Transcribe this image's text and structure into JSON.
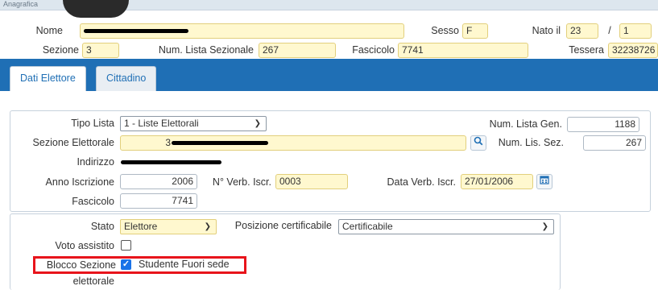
{
  "header": {
    "breadcrumb": "Anagrafica",
    "nome_label": "Nome",
    "sesso_label": "Sesso",
    "sesso_value": "F",
    "nato_il_label": "Nato il",
    "nato_day": "23",
    "date_sep": "/",
    "nato_month": "1",
    "sezione_label": "Sezione",
    "sezione_value": "3",
    "num_lista_sezionale_label": "Num. Lista Sezionale",
    "num_lista_sezionale_value": "267",
    "fascicolo_label": "Fascicolo",
    "fascicolo_value": "7741",
    "tessera_label": "Tessera",
    "tessera_value": "32238726"
  },
  "tabs": [
    {
      "label": "Dati Elettore",
      "active": true
    },
    {
      "label": "Cittadino",
      "active": false
    }
  ],
  "elettore": {
    "tipo_lista_label": "Tipo Lista",
    "tipo_lista_value": "1 - Liste Elettorali",
    "num_lista_gen_label": "Num. Lista Gen.",
    "num_lista_gen_value": "1188",
    "sezione_elettorale_label": "Sezione Elettorale",
    "sezione_elettorale_value": "3",
    "num_lis_sez_label": "Num. Lis. Sez.",
    "num_lis_sez_value": "267",
    "indirizzo_label": "Indirizzo",
    "anno_iscrizione_label": "Anno Iscrizione",
    "anno_iscrizione_value": "2006",
    "n_verb_iscr_label": "N° Verb. Iscr.",
    "n_verb_iscr_value": "0003",
    "data_verb_iscr_label": "Data Verb. Iscr.",
    "data_verb_iscr_value": "27/01/2006",
    "fascicolo_label": "Fascicolo",
    "fascicolo_value": "7741"
  },
  "stato": {
    "stato_label": "Stato",
    "stato_value": "Elettore",
    "posizione_label": "Posizione certificabile",
    "posizione_value": "Certificabile",
    "voto_assistito_label": "Voto assistito",
    "voto_assistito_checked": false,
    "blocco_sezione_label_1": "Blocco Sezione",
    "blocco_sezione_label_2": "elettorale",
    "blocco_checked": true,
    "studente_label": "Studente Fuori sede"
  },
  "colors": {
    "accent": "#1f6fb5",
    "input_yellow": "#fff8cf",
    "highlight": "#e8141b",
    "checkbox": "#1a73e8"
  },
  "icons": [
    "search-icon",
    "calendar-icon",
    "chevron-down-icon",
    "check-icon"
  ]
}
